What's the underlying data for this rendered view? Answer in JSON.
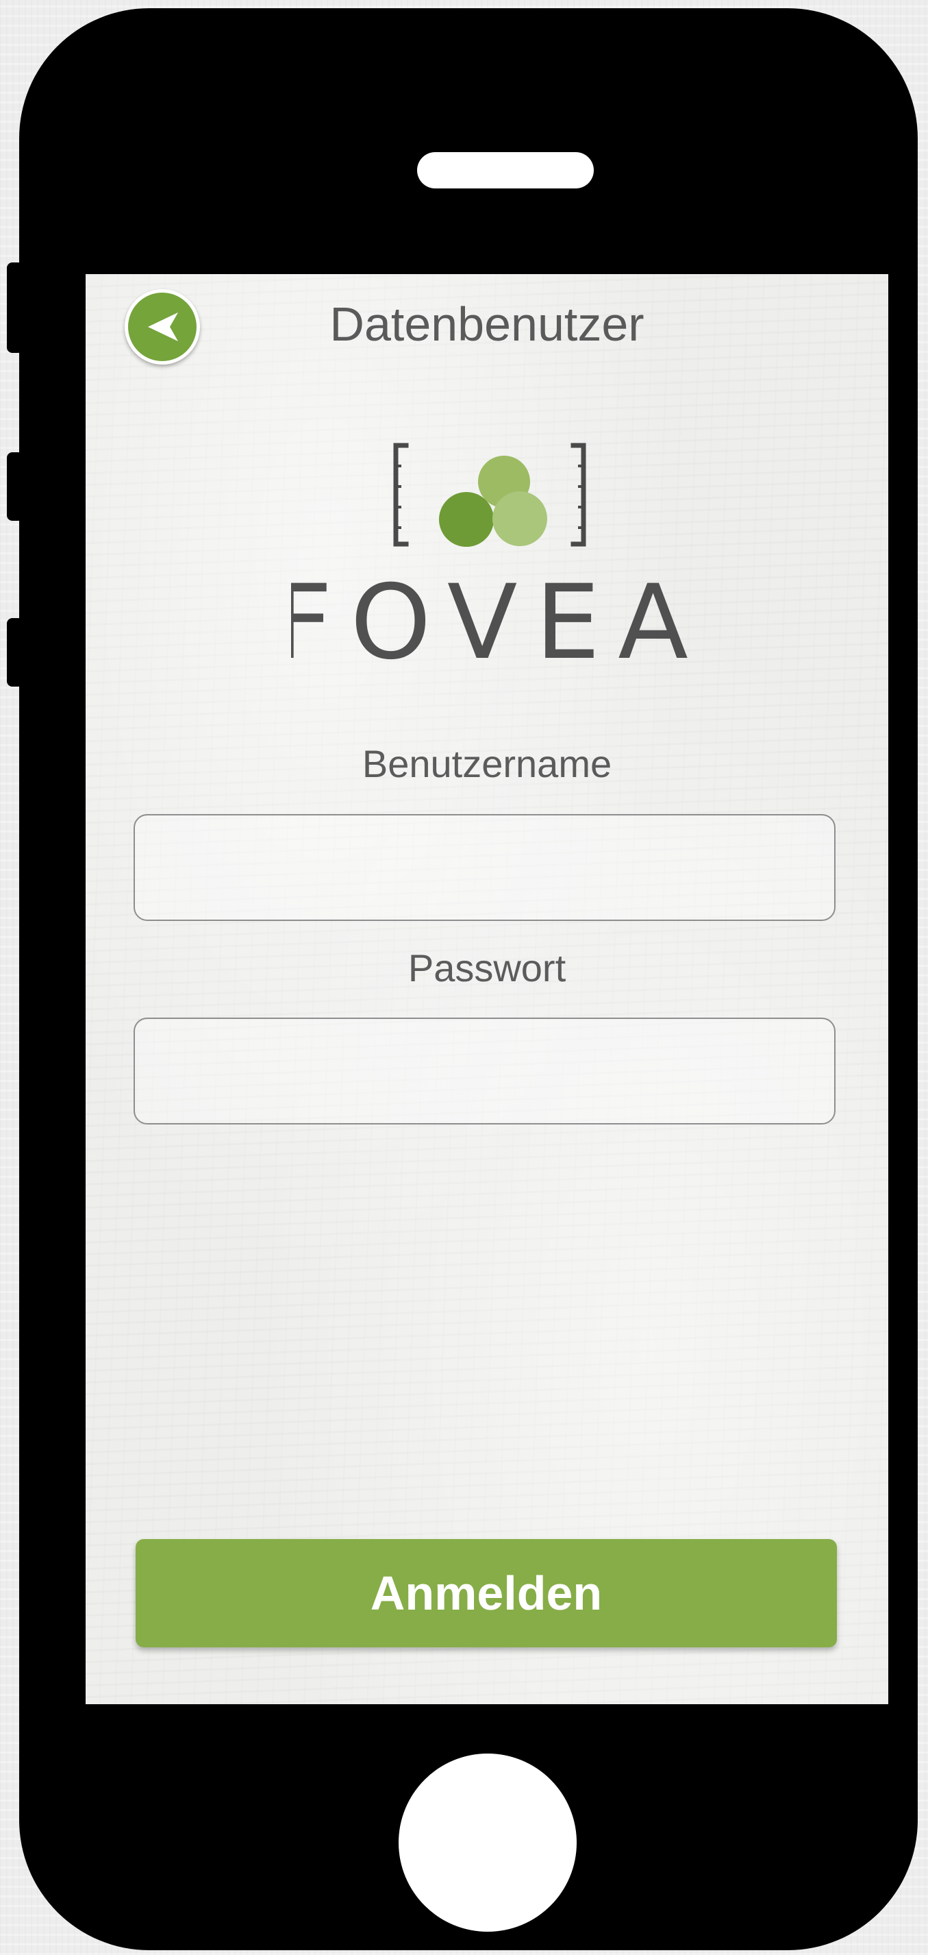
{
  "header": {
    "title": "Datenbenutzer",
    "back_icon": "back-arrow-icon"
  },
  "logo": {
    "wordmark": "FOVEA",
    "icon": "three-circles-bracket-logo"
  },
  "form": {
    "username_label": "Benutzername",
    "username_value": "",
    "password_label": "Passwort",
    "password_value": ""
  },
  "actions": {
    "login_label": "Anmelden"
  },
  "colors": {
    "accent_green": "#86ad47",
    "back_button_green": "#75a43b",
    "text_gray": "#5a5a5a",
    "device_black": "#000000"
  }
}
